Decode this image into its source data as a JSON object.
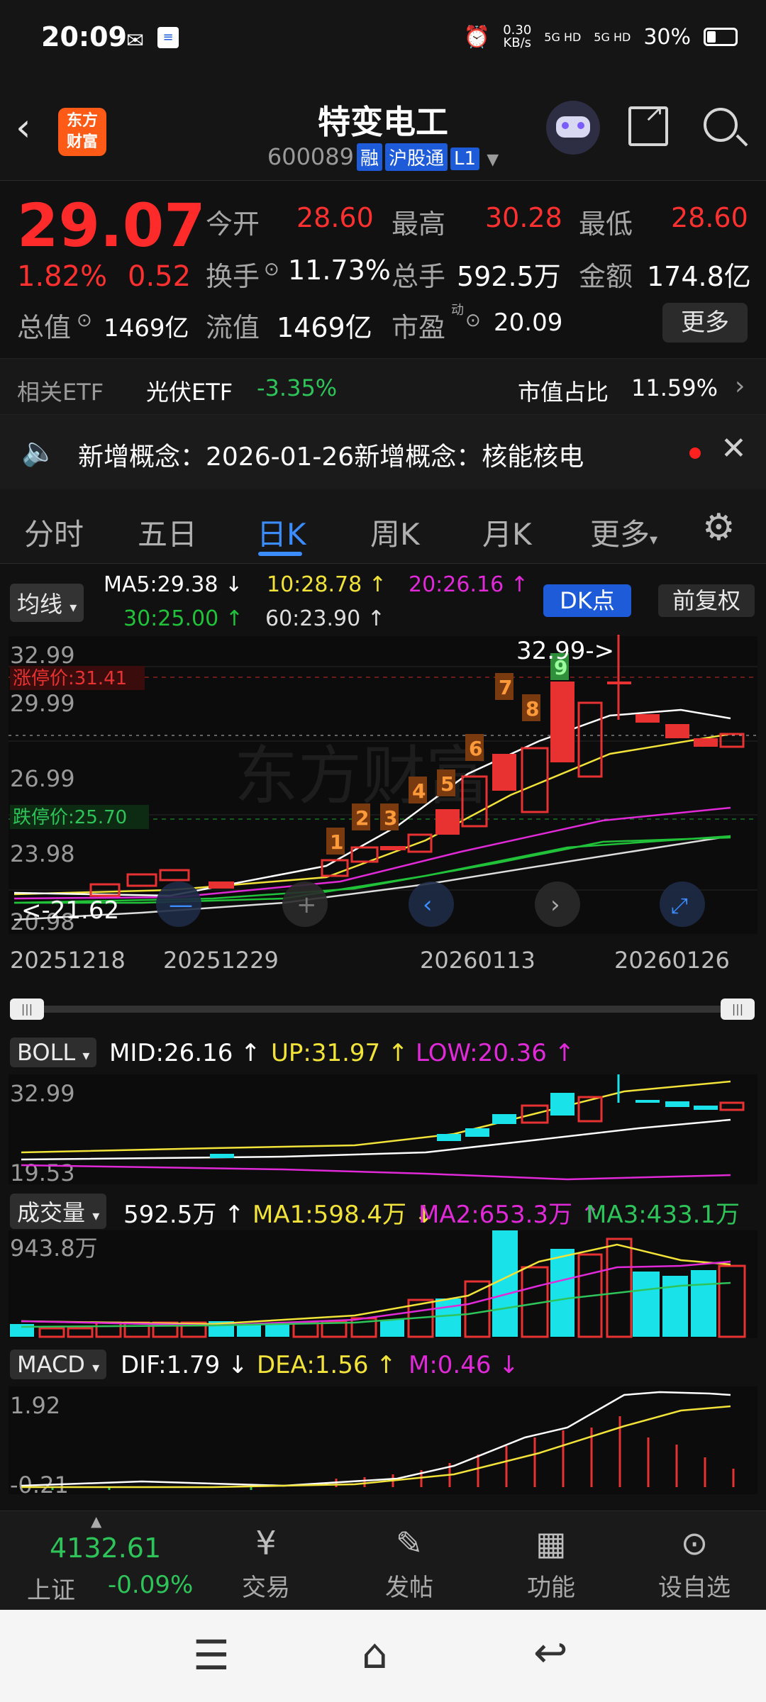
{
  "status": {
    "time": "20:09",
    "net_speed": "0.30\nKB/s",
    "net_speed_top": "0.30",
    "net_speed_bottom": "KB/s",
    "sig1": "5G HD",
    "sig2": "5G HD",
    "battery": "30%"
  },
  "header": {
    "logo_line1": "东方",
    "logo_line2": "财富",
    "title": "特变电工",
    "code": "600089",
    "tag_rong": "融",
    "tag_hgt": "沪股通",
    "tag_level": "L1"
  },
  "quote": {
    "price": "29.07",
    "pct": "1.82%",
    "chg": "0.52",
    "open_label": "今开",
    "open": "28.60",
    "high_label": "最高",
    "high": "30.28",
    "low_label": "最低",
    "low": "28.60",
    "turnover_label": "换手",
    "turnover": "11.73%",
    "volume_label": "总手",
    "volume": "592.5万",
    "amount_label": "金额",
    "amount": "174.8亿",
    "mcap_label": "总值",
    "mcap": "1469亿",
    "float_label": "流值",
    "float": "1469亿",
    "pe_label": "市盈",
    "pe_sup": "动",
    "pe": "20.09",
    "more_label": "更多"
  },
  "etf": {
    "label": "相关ETF",
    "name": "光伏ETF",
    "change": "-3.35%",
    "share_label": "市值占比",
    "share": "11.59%"
  },
  "notice": {
    "text": "新增概念：2026-01-26新增概念：核能核电"
  },
  "tabs": [
    "分时",
    "五日",
    "日K",
    "周K",
    "月K",
    "更多"
  ],
  "ma": {
    "selector": "均线",
    "ma5": "MA5:29.38",
    "ma10": "10:28.78",
    "ma20": "20:26.16",
    "ma30": "30:25.00",
    "ma60": "60:23.90",
    "dk_label": "DK点",
    "fq_label": "前复权"
  },
  "kline": {
    "price_labels": [
      "32.99",
      "29.99",
      "26.99",
      "23.98",
      "20.98"
    ],
    "limit_up": "涨停价:31.41",
    "limit_down": "跌停价:25.70",
    "high_marker": "32.99->",
    "low_marker": "<-21.62",
    "dates": [
      "20251218",
      "20251229",
      "20260113",
      "20260126"
    ],
    "sequence_numbers": [
      "1",
      "2",
      "3",
      "4",
      "5",
      "6",
      "7",
      "8",
      "9"
    ],
    "colors": {
      "up": "#e83232",
      "down": "#19e3e8",
      "ma5": "#ffffff",
      "ma10": "#f2e33a",
      "ma20": "#e02ad8",
      "ma30": "#21c23a",
      "ma60": "#dddddd"
    }
  },
  "boll": {
    "selector": "BOLL",
    "mid": "MID:26.16",
    "up": "UP:31.97",
    "low": "LOW:20.36",
    "top_label": "32.99",
    "bottom_label": "19.53"
  },
  "volume": {
    "selector": "成交量",
    "val": "592.5万",
    "ma1": "MA1:598.4万",
    "ma2": "MA2:653.3万",
    "ma3": "MA3:433.1万",
    "top_label": "943.8万"
  },
  "macd": {
    "selector": "MACD",
    "dif": "DIF:1.79",
    "dea": "DEA:1.56",
    "m": "M:0.46",
    "top_label": "1.92",
    "bottom_label": "-0.21"
  },
  "bottom_nav": {
    "index_value": "4132.61",
    "index_name": "上证",
    "index_change": "-0.09%",
    "trade": "交易",
    "post": "发帖",
    "func": "功能",
    "watch": "设自选"
  }
}
